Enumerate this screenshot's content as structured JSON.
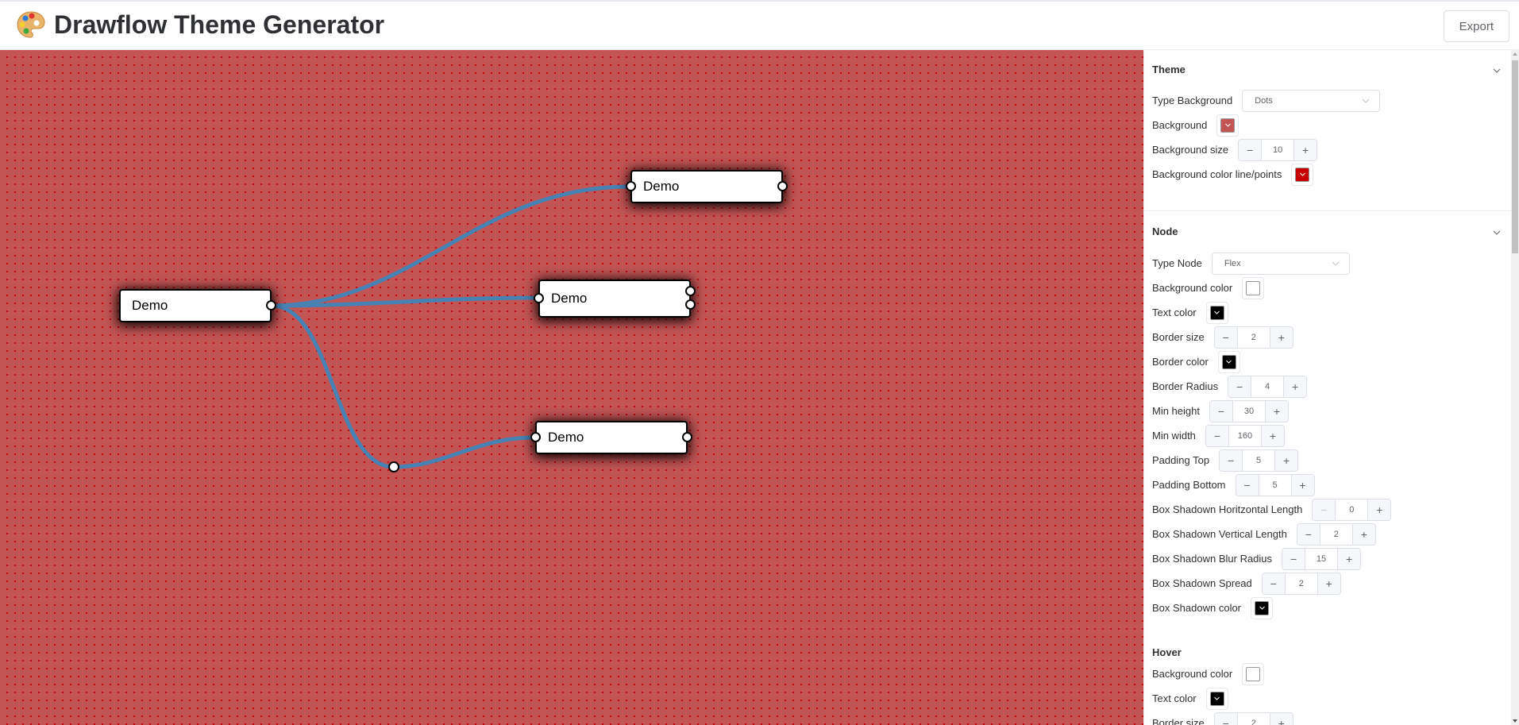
{
  "header": {
    "title": "Drawflow Theme Generator",
    "logo_icon": "artist-palette-icon",
    "export_label": "Export"
  },
  "canvas": {
    "background_color": "#c25454",
    "dot_color": "#c80000",
    "connection_color": "#4682b4",
    "nodes": [
      {
        "id": "node-1",
        "label": "Demo",
        "inputs": 0,
        "outputs": 1
      },
      {
        "id": "node-2",
        "label": "Demo",
        "inputs": 1,
        "outputs": 1
      },
      {
        "id": "node-3",
        "label": "Demo",
        "inputs": 1,
        "outputs": 2
      },
      {
        "id": "node-4",
        "label": "Demo",
        "inputs": 1,
        "outputs": 1
      }
    ]
  },
  "panel": {
    "theme": {
      "title": "Theme",
      "type_background_label": "Type Background",
      "type_background_value": "Dots",
      "background_label": "Background",
      "background_color": "#c25454",
      "background_size_label": "Background size",
      "background_size_value": "10",
      "line_color_label": "Background color line/points",
      "line_color": "#c80000"
    },
    "node": {
      "title": "Node",
      "type_node_label": "Type Node",
      "type_node_value": "Flex",
      "background_color_label": "Background color",
      "background_color": "#ffffff",
      "text_color_label": "Text color",
      "text_color": "#000000",
      "border_size_label": "Border size",
      "border_size_value": "2",
      "border_color_label": "Border color",
      "border_color": "#000000",
      "border_radius_label": "Border Radius",
      "border_radius_value": "4",
      "min_height_label": "Min height",
      "min_height_value": "30",
      "min_width_label": "Min width",
      "min_width_value": "160",
      "padding_top_label": "Padding Top",
      "padding_top_value": "5",
      "padding_bottom_label": "Padding Bottom",
      "padding_bottom_value": "5",
      "shadow_h_label": "Box Shadown Horitzontal Length",
      "shadow_h_value": "0",
      "shadow_v_label": "Box Shadown Vertical Length",
      "shadow_v_value": "2",
      "shadow_blur_label": "Box Shadown Blur Radius",
      "shadow_blur_value": "15",
      "shadow_spread_label": "Box Shadown Spread",
      "shadow_spread_value": "2",
      "shadow_color_label": "Box Shadown color",
      "shadow_color": "#000000"
    },
    "hover": {
      "title": "Hover",
      "background_color_label": "Background color",
      "background_color": "#ffffff",
      "text_color_label": "Text color",
      "text_color": "#000000",
      "border_size_label": "Border size",
      "border_size_value": "2"
    },
    "stepper_minus": "−",
    "stepper_plus": "+"
  }
}
